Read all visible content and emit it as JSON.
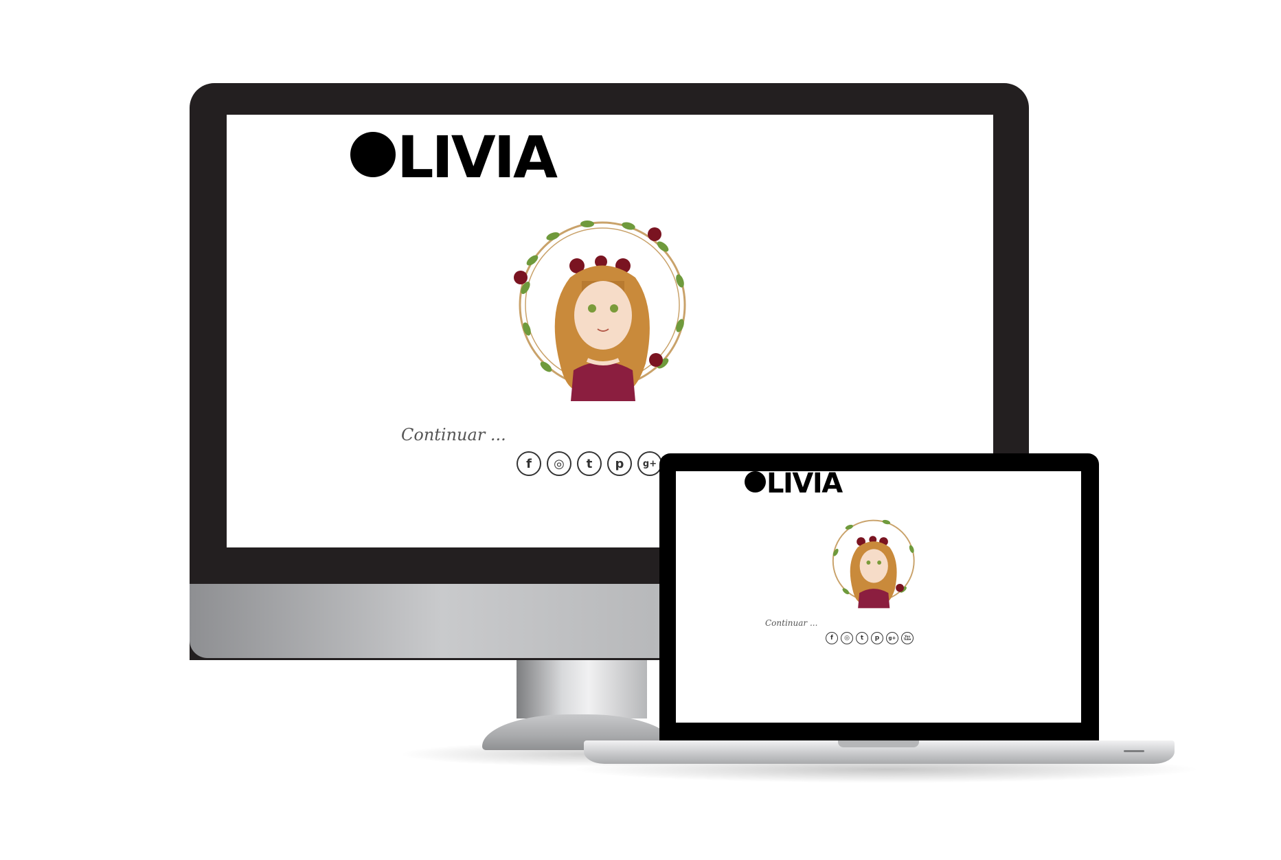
{
  "site": {
    "logo_text": "LIVIA",
    "continue_text": "Continuar ...",
    "social": [
      {
        "icon": "facebook-icon",
        "glyph": "f"
      },
      {
        "icon": "instagram-icon",
        "glyph": "◎"
      },
      {
        "icon": "twitter-icon",
        "glyph": "t"
      },
      {
        "icon": "pinterest-icon",
        "glyph": "p"
      },
      {
        "icon": "google-plus-icon",
        "glyph": "g+"
      },
      {
        "icon": "youtube-icon",
        "glyph": "You\nTube"
      }
    ]
  },
  "colors": {
    "imac_bezel": "#231f20",
    "laptop_bezel": "#000000",
    "hair": "#c98a3b",
    "skin": "#f6dcc8",
    "dress": "#8b1e3f",
    "rose": "#7a1421",
    "leaf": "#6f9a3c",
    "wreath": "#c9a26a"
  }
}
